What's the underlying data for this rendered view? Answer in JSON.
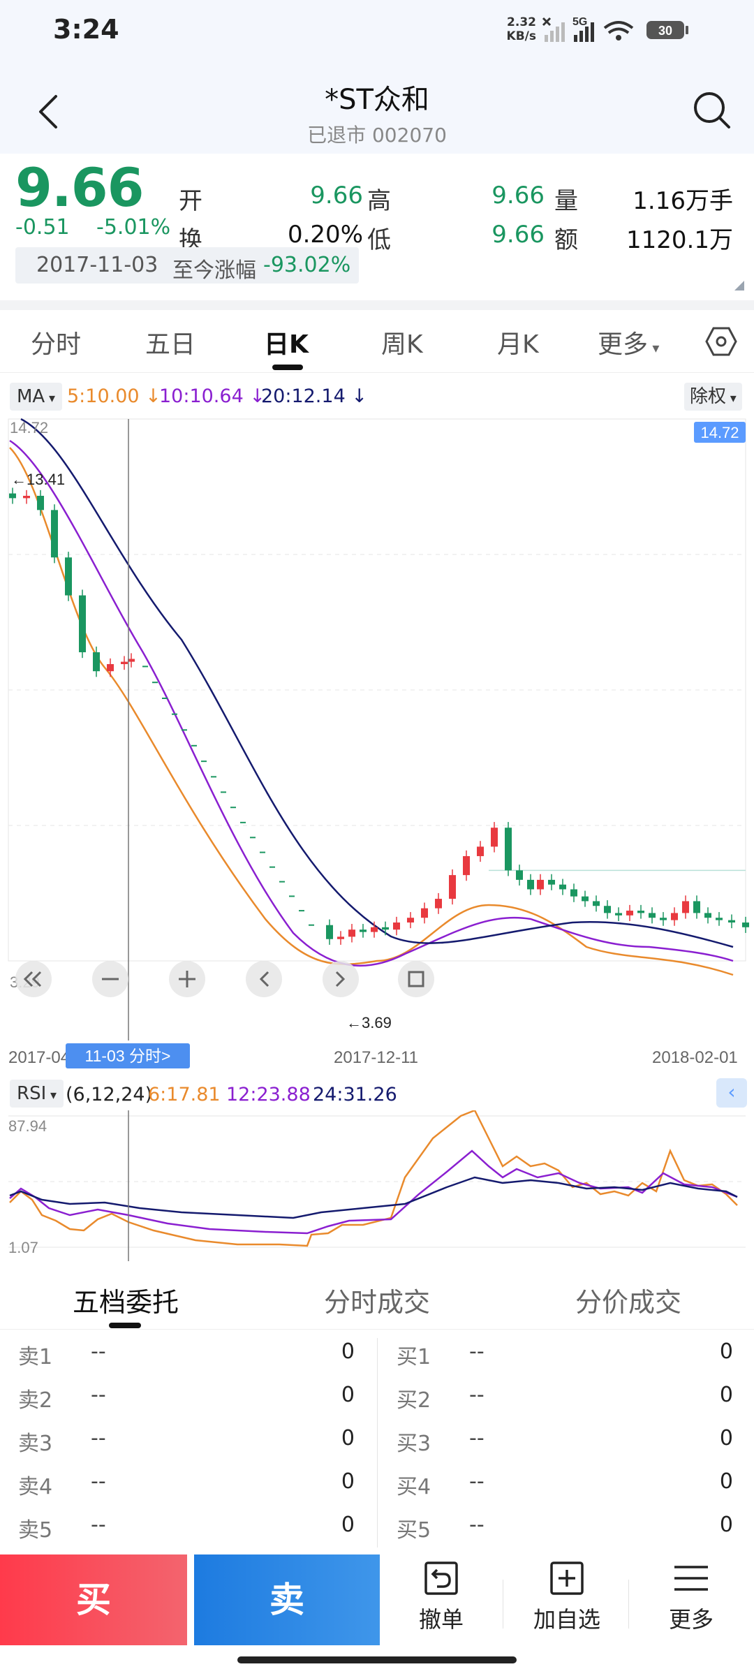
{
  "status_bar": {
    "time": "3:24",
    "speed_value": "2.32",
    "speed_unit": "KB/s",
    "network": "5G",
    "battery": "30"
  },
  "header": {
    "title": "*ST众和",
    "subtitle": "已退市 002070"
  },
  "quote": {
    "price": "9.66",
    "change": "-0.51",
    "change_pct": "-5.01%",
    "open_label": "开",
    "open": "9.66",
    "high_label": "高",
    "high": "9.66",
    "volume_label": "量",
    "volume": "1.16万手",
    "turnover_label": "换",
    "turnover": "0.20%",
    "low_label": "低",
    "low": "9.66",
    "amount_label": "额",
    "amount": "1120.1万",
    "since_date": "2017-11-03",
    "since_label": "至今涨幅",
    "since_value": "-93.02%",
    "colors": {
      "down": "#1a9660",
      "up": "#e8393f"
    }
  },
  "period_tabs": [
    "分时",
    "五日",
    "日K",
    "周K",
    "月K",
    "更多"
  ],
  "active_period": "日K",
  "ma_bar": {
    "button": "MA",
    "ma5": "5:10.00",
    "ma10": "10:10.64",
    "ma20": "20:12.14",
    "fq": "除权",
    "colors": {
      "ma5": "#e98a2c",
      "ma10": "#8a1fd0",
      "ma20": "#141a6e"
    }
  },
  "kline": {
    "y_max": "14.72",
    "y_min": "3.29",
    "y_max_tag": "14.72",
    "high_marker": "←13.41",
    "low_marker": "←3.69",
    "date_start": "2017-04",
    "date_mid": "2017-12-11",
    "date_end": "2018-02-01",
    "cursor_tag": "11-03 分时>"
  },
  "rsi": {
    "button": "RSI",
    "params": "(6,12,24)",
    "rsi6": "6:17.81",
    "rsi12": "12:23.88",
    "rsi24": "24:31.26",
    "y_max": "87.94",
    "y_min": "1.07"
  },
  "chart_data": {
    "type": "candlestick",
    "y_range": [
      3.29,
      14.72
    ],
    "price_marks": {
      "high": 13.41,
      "low": 3.69
    },
    "x_labels": [
      "2017-04",
      "2017-12-11",
      "2018-02-01"
    ],
    "series": [
      {
        "name": "MA5",
        "last": 10.0
      },
      {
        "name": "MA10",
        "last": 10.64
      },
      {
        "name": "MA20",
        "last": 12.14
      }
    ],
    "rsi": {
      "range": [
        1.07,
        87.94
      ],
      "RSI6": 17.81,
      "RSI12": 23.88,
      "RSI24": 31.26
    }
  },
  "order_tabs": [
    "五档委托",
    "分时成交",
    "分价成交"
  ],
  "order_book": {
    "sell": [
      {
        "label": "卖1",
        "price": "--",
        "volume": "0"
      },
      {
        "label": "卖2",
        "price": "--",
        "volume": "0"
      },
      {
        "label": "卖3",
        "price": "--",
        "volume": "0"
      },
      {
        "label": "卖4",
        "price": "--",
        "volume": "0"
      },
      {
        "label": "卖5",
        "price": "--",
        "volume": "0"
      }
    ],
    "buy": [
      {
        "label": "买1",
        "price": "--",
        "volume": "0"
      },
      {
        "label": "买2",
        "price": "--",
        "volume": "0"
      },
      {
        "label": "买3",
        "price": "--",
        "volume": "0"
      },
      {
        "label": "买4",
        "price": "--",
        "volume": "0"
      },
      {
        "label": "买5",
        "price": "--",
        "volume": "0"
      }
    ]
  },
  "bottom_bar": {
    "buy": "买",
    "sell": "卖",
    "cancel": "撤单",
    "add_watch": "加自选",
    "more": "更多"
  }
}
